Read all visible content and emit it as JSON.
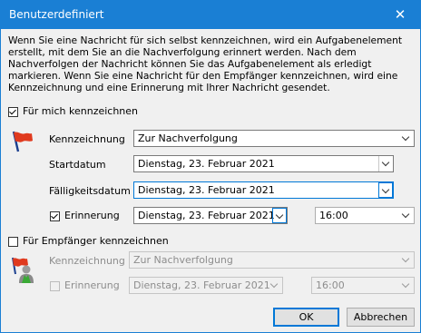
{
  "window": {
    "title": "Benutzerdefiniert",
    "close_glyph": "✕"
  },
  "description": "Wenn Sie eine Nachricht für sich selbst kennzeichnen, wird ein Aufgabenelement erstellt, mit dem Sie an die Nachverfolgung erinnert werden. Nach dem Nachverfolgen der Nachricht können Sie das Aufgabenelement als erledigt markieren. Wenn Sie eine Nachricht für den Empfänger kennzeichnen, wird eine Kennzeichnung und eine Erinnerung mit Ihrer Nachricht gesendet.",
  "self_section": {
    "checkbox_label": "Für mich kennzeichnen",
    "checked": true,
    "icon": "red-flag-icon",
    "flag_label": "Kennzeichnung",
    "flag_value": "Zur Nachverfolgung",
    "start_label": "Startdatum",
    "start_value": "Dienstag, 23. Februar 2021",
    "due_label": "Fälligkeitsdatum",
    "due_value": "Dienstag, 23. Februar 2021",
    "reminder_label": "Erinnerung",
    "reminder_checked": true,
    "reminder_date": "Dienstag, 23. Februar 2021",
    "reminder_time": "16:00"
  },
  "recipient_section": {
    "checkbox_label": "Für Empfänger kennzeichnen",
    "checked": false,
    "icon": "recipient-flag-icon",
    "flag_label": "Kennzeichnung",
    "flag_value": "Zur Nachverfolgung",
    "reminder_label": "Erinnerung",
    "reminder_checked": false,
    "reminder_date": "Dienstag, 23. Februar 2021",
    "reminder_time": "16:00"
  },
  "buttons": {
    "ok": "OK",
    "cancel": "Abbrechen"
  },
  "colors": {
    "title_bar": "#1a7fd4",
    "focus": "#0078d7",
    "flag_red": "#e03a1e"
  }
}
